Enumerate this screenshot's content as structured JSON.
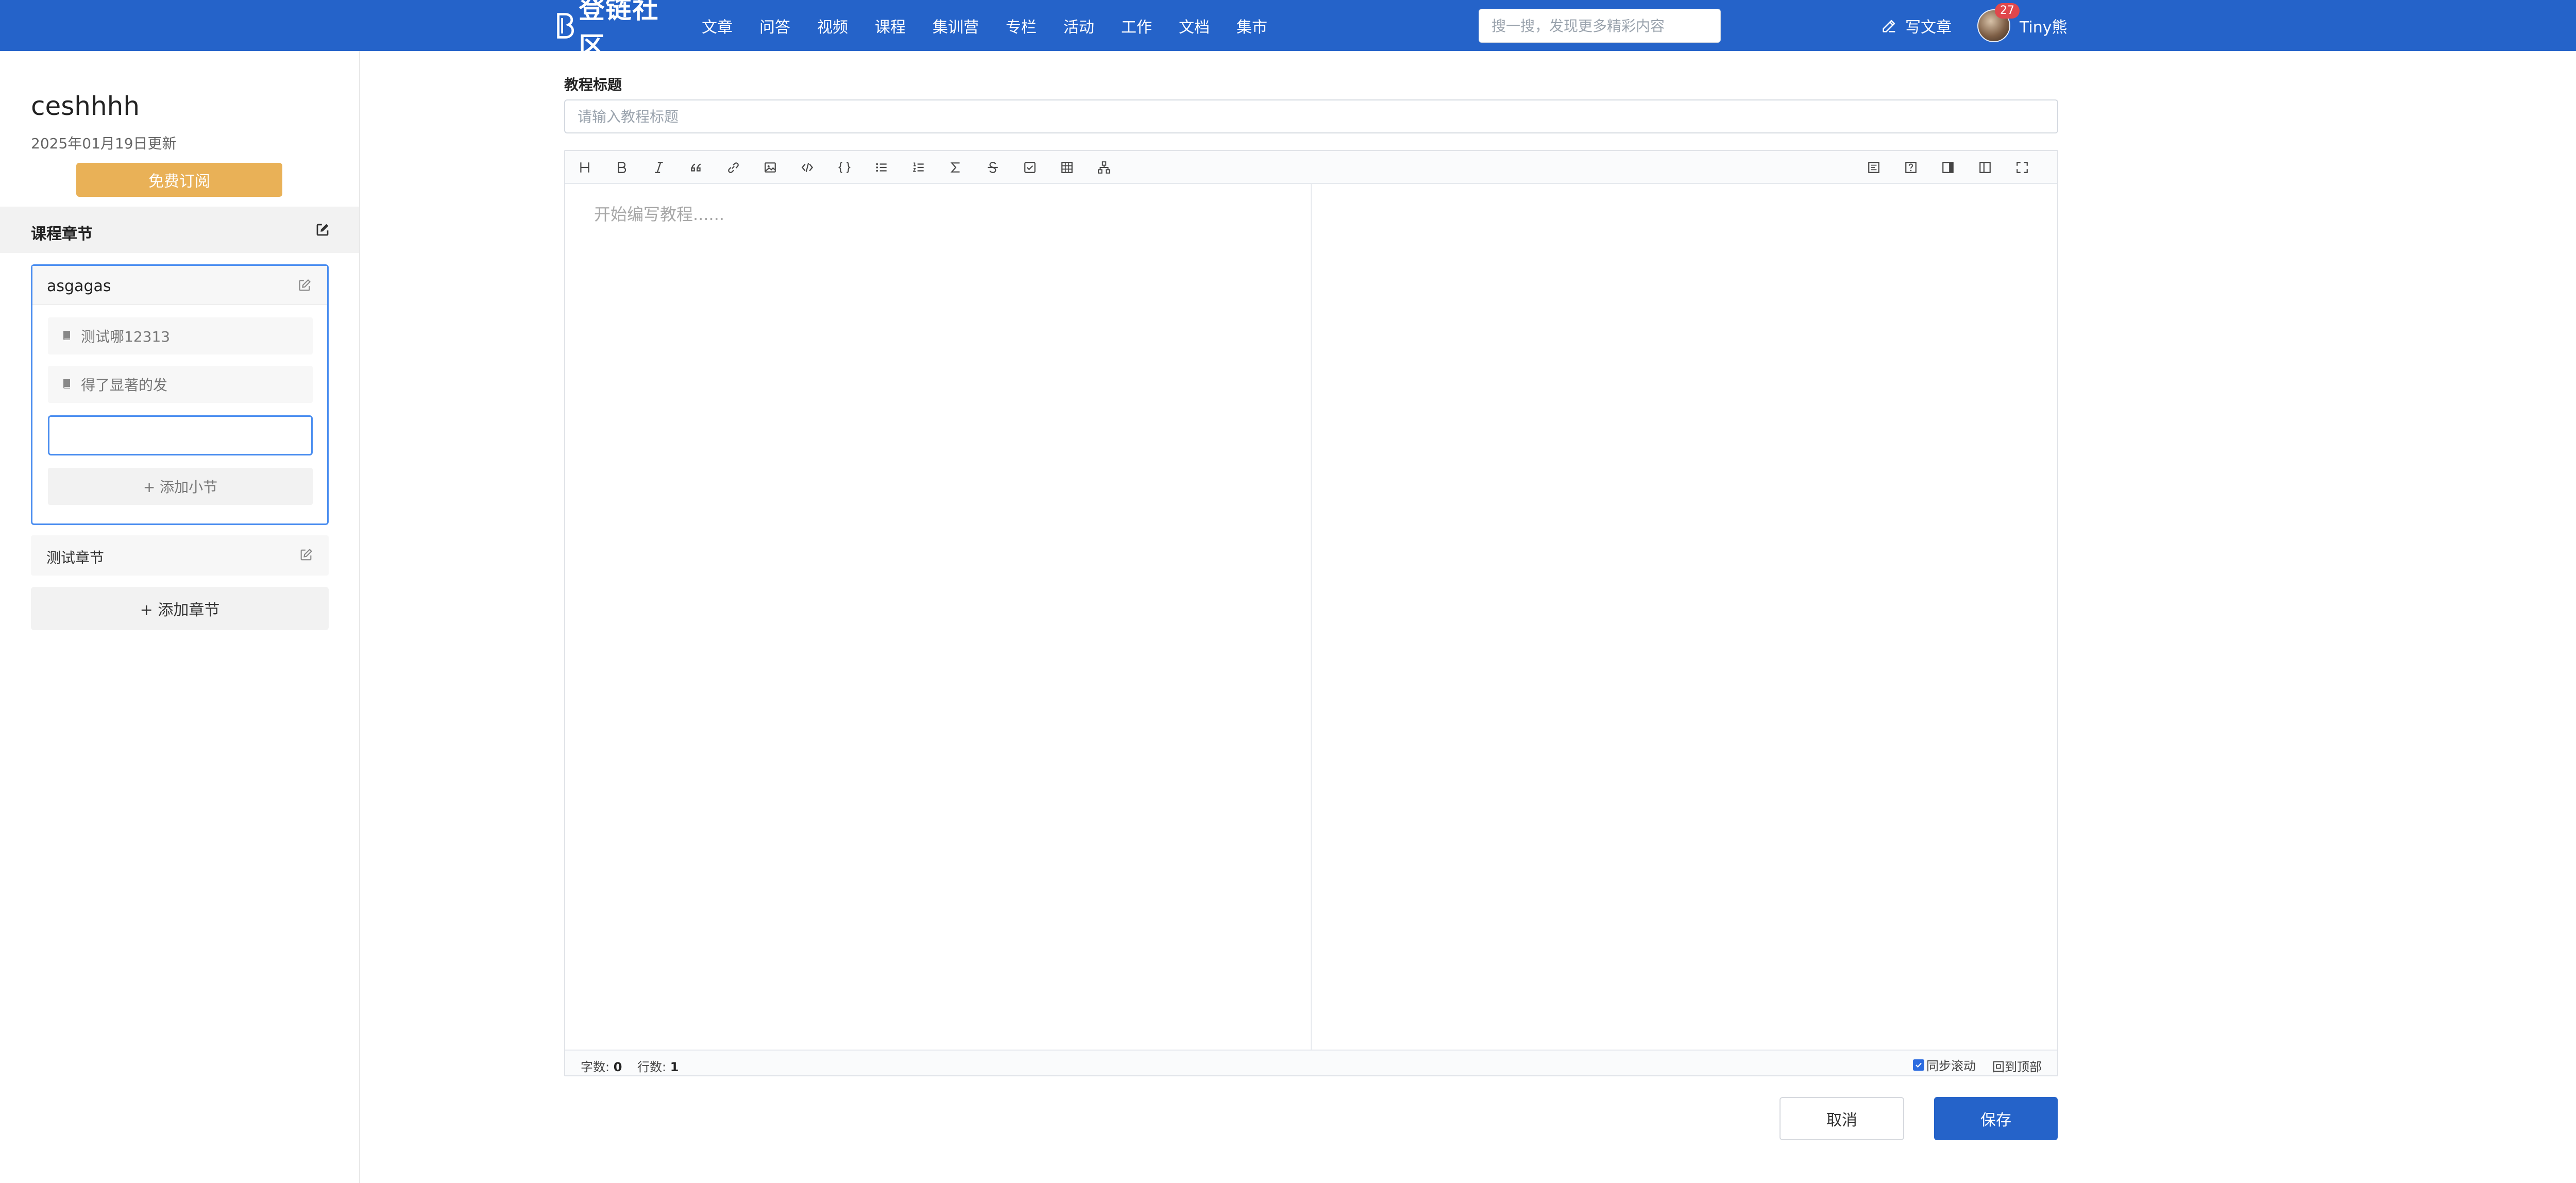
{
  "header": {
    "logo_text": "登链社区",
    "nav": [
      "文章",
      "问答",
      "视频",
      "课程",
      "集训营",
      "专栏",
      "活动",
      "工作",
      "文档",
      "集市"
    ],
    "search_placeholder": "搜一搜，发现更多精彩内容",
    "write_label": "写文章",
    "notification_count": "27",
    "username": "Tiny熊"
  },
  "sidebar": {
    "course_title": "ceshhhh",
    "updated": "2025年01月19日更新",
    "subscribe_label": "免费订阅",
    "chapters_heading": "课程章节",
    "active_chapter": {
      "name": "asgagas",
      "sections": [
        "测试哪12313",
        "得了显著的发"
      ],
      "new_section_value": "",
      "add_section_label": "+ 添加小节"
    },
    "other_chapter": "测试章节",
    "add_chapter_label": "+ 添加章节"
  },
  "main": {
    "title_label": "教程标题",
    "title_placeholder": "请输入教程标题",
    "editor_placeholder": "开始编写教程......",
    "stats": {
      "words_label": "字数:",
      "words": "0",
      "lines_label": "行数:",
      "lines": "1"
    },
    "sync_scroll_label": "同步滚动",
    "sync_scroll_checked": true,
    "back_to_top_label": "回到顶部",
    "cancel_label": "取消",
    "save_label": "保存"
  },
  "toolbar_icons": [
    "heading-icon",
    "bold-icon",
    "italic-icon",
    "quote-icon",
    "link-icon",
    "image-icon",
    "code-icon",
    "code-block-icon",
    "unordered-list-icon",
    "ordered-list-icon",
    "formula-icon",
    "strikethrough-icon",
    "task-list-icon",
    "table-icon",
    "diagram-icon"
  ],
  "toolbar_right_icons": [
    "toc-icon",
    "help-icon",
    "preview-only-icon",
    "editor-only-icon",
    "fullscreen-icon"
  ],
  "colors": {
    "brand": "#2563c9",
    "subscribe": "#e9b157",
    "active_border": "#4b8ef0"
  }
}
